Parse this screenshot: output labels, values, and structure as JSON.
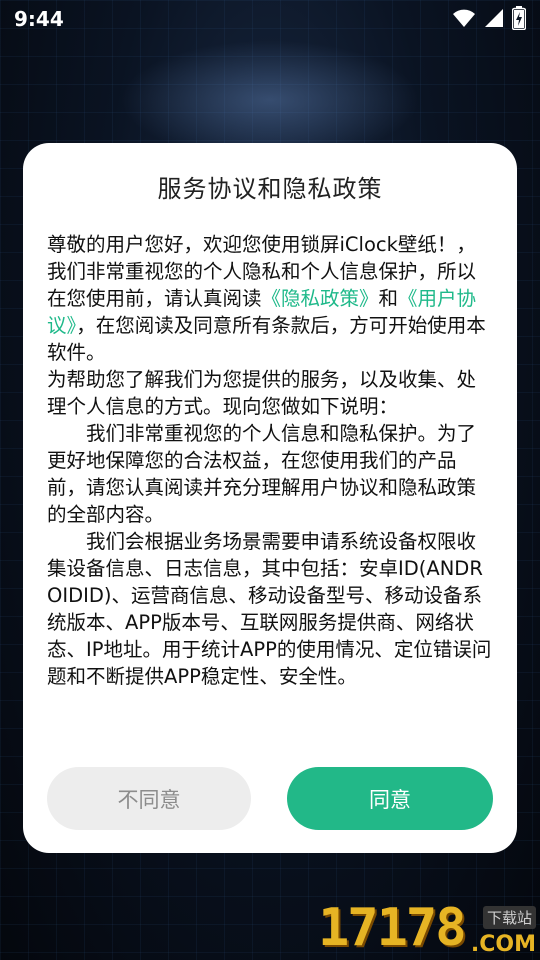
{
  "status_bar": {
    "time": "9:44",
    "icons": [
      "wifi-icon",
      "signal-icon",
      "battery-charging-icon"
    ]
  },
  "dialog": {
    "title": "服务协议和隐私政策",
    "para1": {
      "before": "尊敬的用户您好，欢迎您使用锁屏iClock壁纸！，我们非常重视您的个人隐私和个人信息保护，所以在您使用前，请认真阅读",
      "link_privacy": "《隐私政策》",
      "and": "和",
      "link_agreement": "《用户协议》",
      "after": "，在您阅读及同意所有条款后，方可开始使用本软件。"
    },
    "para2": "为帮助您了解我们为您提供的服务，以及收集、处理个人信息的方式。现向您做如下说明：",
    "para3": "我们非常重视您的个人信息和隐私保护。为了更好地保障您的合法权益，在您使用我们的产品前，请您认真阅读并充分理解用户协议和隐私政策的全部内容。",
    "para4": "我们会根据业务场景需要申请系统设备权限收集设备信息、日志信息，其中包括：安卓ID(ANDROIDID)、运营商信息、移动设备型号、移动设备系统版本、APP版本号、互联网服务提供商、网络状态、IP地址。用于统计APP的使用情况、定位错误问题和不断提供APP稳定性、安全性。",
    "disagree_label": "不同意",
    "agree_label": "同意"
  },
  "watermark": {
    "number": "17178",
    "tag": "下载站",
    "domain": ".COM"
  },
  "colors": {
    "accent": "#22b888",
    "link": "#1fb98a",
    "disagree_bg": "#ededed"
  }
}
